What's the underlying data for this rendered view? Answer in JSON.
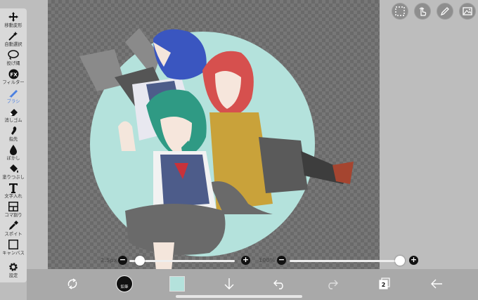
{
  "toolbar": {
    "tools": [
      {
        "label": "移動変形",
        "icon": "move-icon"
      },
      {
        "label": "自動選択",
        "icon": "magic-wand-icon"
      },
      {
        "label": "投げ縄",
        "icon": "lasso-icon"
      },
      {
        "label": "フィルター",
        "icon": "fx-icon"
      },
      {
        "label": "ブラシ",
        "icon": "brush-icon",
        "active": true
      },
      {
        "label": "消しゴム",
        "icon": "eraser-icon"
      },
      {
        "label": "指先",
        "icon": "finger-icon"
      },
      {
        "label": "ぼかし",
        "icon": "blur-drop-icon"
      },
      {
        "label": "塗りつぶし",
        "icon": "bucket-icon"
      },
      {
        "label": "文字入れ",
        "icon": "text-icon"
      },
      {
        "label": "コマ割り",
        "icon": "frame-divider-icon"
      },
      {
        "label": "スポイト",
        "icon": "eyedropper-icon"
      },
      {
        "label": "キャンバス",
        "icon": "canvas-icon"
      },
      {
        "label": "設定",
        "icon": "gear-icon"
      }
    ]
  },
  "sliders": {
    "brush_size": {
      "label": "2.5px",
      "value_fraction": 0.2
    },
    "opacity": {
      "label": "100%",
      "value_fraction": 1.0
    }
  },
  "bottom": {
    "brush_button_label": "鉛筆",
    "current_color": "#b4e2dc",
    "layer_count": "2"
  },
  "colors": {
    "accent": "#4a7fe0",
    "circle_bg": "#b4e2dc"
  }
}
